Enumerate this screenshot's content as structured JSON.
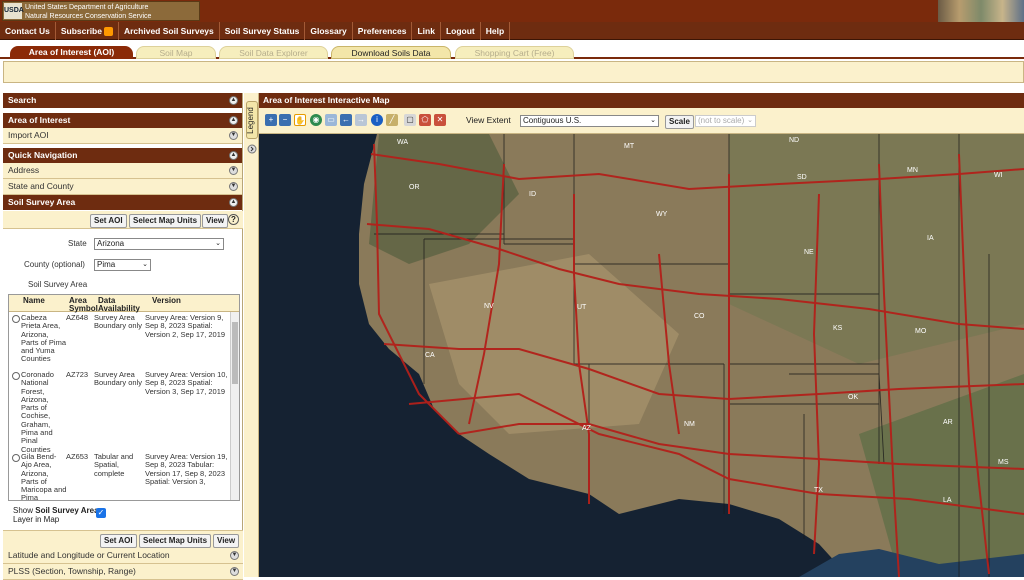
{
  "header": {
    "logo": "USDA",
    "agency_line1": "United States Department of Agriculture",
    "agency_line2": "Natural Resources Conservation Service"
  },
  "topnav": [
    {
      "label": "Contact Us"
    },
    {
      "label": "Subscribe",
      "icon": "rss-icon"
    },
    {
      "label": "Archived Soil Surveys"
    },
    {
      "label": "Soil Survey Status"
    },
    {
      "label": "Glossary"
    },
    {
      "label": "Preferences"
    },
    {
      "label": "Link"
    },
    {
      "label": "Logout"
    },
    {
      "label": "Help"
    }
  ],
  "tabs": [
    {
      "label": "Area of Interest (AOI)",
      "state": "active"
    },
    {
      "label": "Soil Map",
      "state": "disabled"
    },
    {
      "label": "Soil Data Explorer",
      "state": "disabled"
    },
    {
      "label": "Download Soils Data",
      "state": "enabled"
    },
    {
      "label": "Shopping Cart (Free)",
      "state": "disabled"
    }
  ],
  "left": {
    "search": "Search",
    "aoi": "Area of Interest",
    "import_aoi": "Import AOI",
    "quick_nav": "Quick Navigation",
    "address": "Address",
    "state_county": "State and County",
    "ssa": "Soil Survey Area",
    "set_aoi": "Set AOI",
    "select_map_units": "Select Map Units",
    "view": "View",
    "help": "?",
    "state_label": "State",
    "state_value": "Arizona",
    "county_label": "County (optional)",
    "county_value": "Pima",
    "ssa_label": "Soil Survey Area",
    "table_headers": {
      "name": "Name",
      "symbol": "Area Symbol",
      "availability": "Data Availability",
      "version": "Version"
    },
    "rows": [
      {
        "name": "Cabeza Prieta Area, Arizona, Parts of Pima and Yuma Counties",
        "symbol": "AZ648",
        "availability": "Survey Area Boundary only",
        "version": "Survey Area: Version 9, Sep 8, 2023 Spatial: Version 2, Sep 17, 2019"
      },
      {
        "name": "Coronado National Forest, Arizona, Parts of Cochise, Graham, Pima and Pinal Counties",
        "symbol": "AZ723",
        "availability": "Survey Area Boundary only",
        "version": "Survey Area: Version 10, Sep 8, 2023 Spatial: Version 3, Sep 17, 2019"
      },
      {
        "name": "Gila Bend-Ajo Area, Arizona, Parts of Maricopa and Pima",
        "symbol": "AZ653",
        "availability": "Tabular and Spatial, complete",
        "version": "Survey Area: Version 19, Sep 8, 2023 Tabular: Version 17, Sep 8, 2023 Spatial: Version 3,"
      }
    ],
    "show_prefix": "Show ",
    "show_bold": "Soil Survey Areas",
    "show_suffix": " Layer in Map",
    "show_checked": true,
    "latlon": "Latitude and Longitude or Current Location",
    "plss": "PLSS (Section, Township, Range)"
  },
  "legend_label": "Legend",
  "map": {
    "title": "Area of Interest Interactive Map",
    "view_extent_label": "View Extent",
    "view_extent_value": "Contiguous U.S.",
    "scale_label": "Scale",
    "scale_value": "(not to scale)",
    "tools": [
      "zoom-in-icon",
      "zoom-out-icon",
      "pan-icon",
      "globe-icon",
      "full-extent-icon",
      "back-icon",
      "forward-icon",
      "identify-icon",
      "measure-icon",
      "aoi-rectangle-icon",
      "aoi-polygon-icon",
      "clear-aoi-icon"
    ],
    "state_labels": [
      "WA",
      "OR",
      "ID",
      "MT",
      "WY",
      "ND",
      "SD",
      "MN",
      "WI",
      "NE",
      "IA",
      "NV",
      "UT",
      "CO",
      "KS",
      "MO",
      "CA",
      "AZ",
      "NM",
      "OK",
      "AR",
      "TX",
      "LA",
      "MS"
    ],
    "colors": {
      "road": "#b3201a",
      "land": "#8a7a5a",
      "ocean": "#152232"
    }
  }
}
